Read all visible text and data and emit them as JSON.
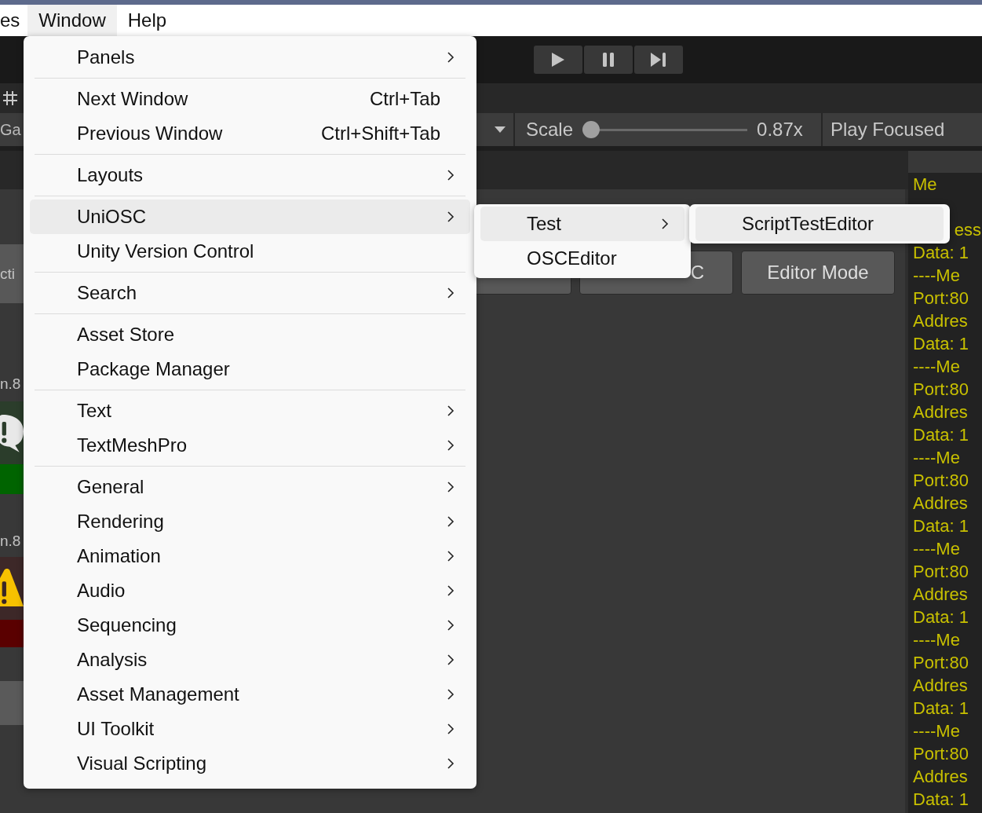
{
  "menubar": [
    {
      "label": "es",
      "selected": false
    },
    {
      "label": "Window",
      "selected": true
    },
    {
      "label": "Help",
      "selected": false
    }
  ],
  "toolbar": {
    "buttons": [
      {
        "kind": "play"
      },
      {
        "kind": "pause"
      },
      {
        "kind": "step"
      }
    ]
  },
  "left_panel": {
    "texts": [
      "Ga",
      "cti",
      "n.8",
      "n.8"
    ]
  },
  "game_view": {
    "scale_label": "Scale",
    "scale": {
      "level": 0
    },
    "scale_reading": "0.87x",
    "play_mode": "Play Focused"
  },
  "panel_buttons": [
    "C",
    "Editor Mode"
  ],
  "console": {
    "lines": [
      {
        "text": "Me",
        "kind": "full"
      },
      {
        "text": "ess",
        "kind": "tail"
      },
      {
        "text": "Data: 1",
        "kind": "full"
      },
      {
        "text": "----Me",
        "kind": "full"
      },
      {
        "text": "Port:80",
        "kind": "full"
      },
      {
        "text": "Addres",
        "kind": "full"
      },
      {
        "text": "Data: 1",
        "kind": "full"
      },
      {
        "text": "----Me",
        "kind": "full"
      },
      {
        "text": "Port:80",
        "kind": "full"
      },
      {
        "text": "Addres",
        "kind": "full"
      },
      {
        "text": "Data: 1",
        "kind": "full"
      },
      {
        "text": "----Me",
        "kind": "full"
      },
      {
        "text": "Port:80",
        "kind": "full"
      },
      {
        "text": "Addres",
        "kind": "full"
      },
      {
        "text": "Data: 1",
        "kind": "full"
      },
      {
        "text": "----Me",
        "kind": "full"
      },
      {
        "text": "Port:80",
        "kind": "full"
      },
      {
        "text": "Addres",
        "kind": "full"
      },
      {
        "text": "Data: 1",
        "kind": "full"
      },
      {
        "text": "----Me",
        "kind": "full"
      },
      {
        "text": "Port:80",
        "kind": "full"
      },
      {
        "text": "Addres",
        "kind": "full"
      },
      {
        "text": "Data: 1",
        "kind": "full"
      },
      {
        "text": "----Me",
        "kind": "full"
      },
      {
        "text": "Port:80",
        "kind": "full"
      },
      {
        "text": "Addres",
        "kind": "full"
      },
      {
        "text": "Data: 1",
        "kind": "full"
      }
    ]
  },
  "window_menu": {
    "groups": [
      [
        {
          "label": "Panels",
          "submenu": true,
          "selected": false
        }
      ],
      [
        {
          "label": "Next Window",
          "shortcut": "Ctrl+Tab",
          "submenu": false,
          "selected": false
        },
        {
          "label": "Previous Window",
          "shortcut": "Ctrl+Shift+Tab",
          "submenu": false,
          "selected": false
        }
      ],
      [
        {
          "label": "Layouts",
          "submenu": true,
          "selected": false
        }
      ],
      [
        {
          "label": "UniOSC",
          "submenu": true,
          "selected": true
        },
        {
          "label": "Unity Version Control",
          "submenu": false,
          "selected": false
        }
      ],
      [
        {
          "label": "Search",
          "submenu": true,
          "selected": false
        }
      ],
      [
        {
          "label": "Asset Store",
          "submenu": false,
          "selected": false
        },
        {
          "label": "Package Manager",
          "submenu": false,
          "selected": false
        }
      ],
      [
        {
          "label": "Text",
          "submenu": true,
          "selected": false
        },
        {
          "label": "TextMeshPro",
          "submenu": true,
          "selected": false
        }
      ],
      [
        {
          "label": "General",
          "submenu": true,
          "selected": false
        },
        {
          "label": "Rendering",
          "submenu": true,
          "selected": false
        },
        {
          "label": "Animation",
          "submenu": true,
          "selected": false
        },
        {
          "label": "Audio",
          "submenu": true,
          "selected": false
        },
        {
          "label": "Sequencing",
          "submenu": true,
          "selected": false
        },
        {
          "label": "Analysis",
          "submenu": true,
          "selected": false
        },
        {
          "label": "Asset Management",
          "submenu": true,
          "selected": false
        },
        {
          "label": "UI Toolkit",
          "submenu": true,
          "selected": false
        },
        {
          "label": "Visual Scripting",
          "submenu": true,
          "selected": false
        }
      ]
    ]
  },
  "uniosc_submenu": [
    {
      "label": "Test",
      "submenu": true,
      "selected": true
    },
    {
      "label": "OSCEditor",
      "submenu": false,
      "selected": false
    }
  ],
  "test_submenu": [
    {
      "label": "ScriptTestEditor",
      "submenu": false,
      "selected": true
    }
  ]
}
